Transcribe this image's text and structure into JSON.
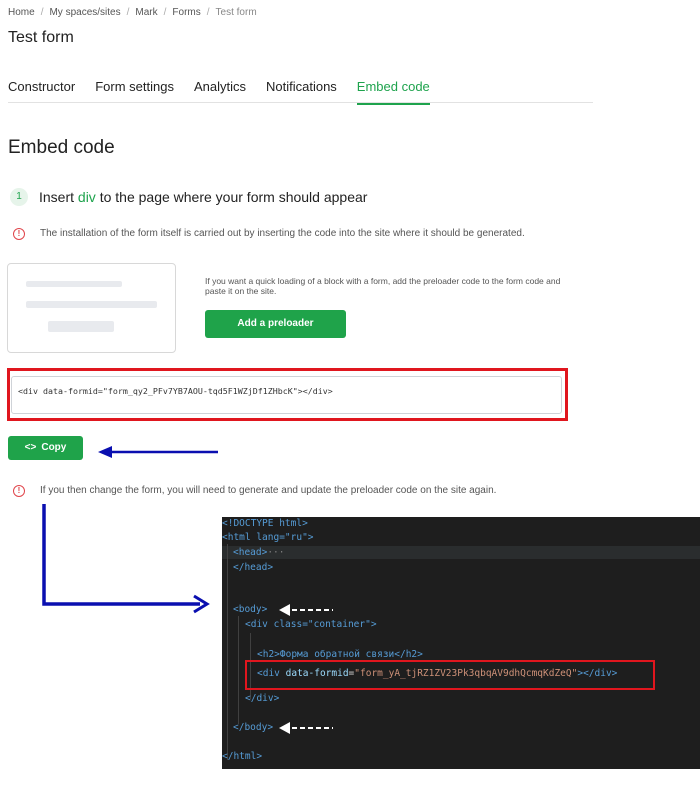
{
  "breadcrumb": [
    "Home",
    "My spaces/sites",
    "Mark",
    "Forms",
    "Test form"
  ],
  "page_title": "Test form",
  "tabs": [
    {
      "label": "Constructor"
    },
    {
      "label": "Form settings"
    },
    {
      "label": "Analytics"
    },
    {
      "label": "Notifications"
    },
    {
      "label": "Embed code",
      "active": true
    }
  ],
  "section_title": "Embed code",
  "step": {
    "number": "1",
    "text_before": "Insert ",
    "highlight": "div",
    "text_after": " to the page where your form should appear"
  },
  "notes": {
    "install": "The installation of the form itself is carried out by inserting the code into the site where it should be generated.",
    "preloader": "If you want a quick loading of a block with a form, add the preloader code to the form code and paste it on the site.",
    "change": "If you then change the form, you will need to generate and update the preloader code on the site again."
  },
  "buttons": {
    "add_preloader": "Add a preloader",
    "copy": "Copy",
    "copy_icon": "<>"
  },
  "embed_code": "<div data-formid=\"form_qy2_PFv7YB7AOU-tqd5F1WZjDf1ZHbcK\"></div>",
  "editor": {
    "doctype": "<!DOCTYPE html>",
    "html_open": "<html lang=\"ru\">",
    "head_open": "<head>",
    "head_fold": "···",
    "head_close": "</head>",
    "body_open": "<body>",
    "div_open": "<div class=\"container\">",
    "h2": "<h2>Форма обратной связи</h2>",
    "form_div_tag": "<div",
    "form_div_attr": "data-formid",
    "form_div_val": "\"form_yA_tjRZ1ZV23Pk3qbqAV9dhQcmqKdZeQ\"",
    "form_div_end": "></div>",
    "div_close": "</div>",
    "body_close": "</body>",
    "html_close": "</html>"
  },
  "colors": {
    "accent_green": "#1ea34d",
    "button_green": "#1fa34a",
    "highlight_red": "#e0161e",
    "annotation_blue": "#0a0fb0",
    "info_red": "#e0454b",
    "editor_bg": "#1e1e1e"
  }
}
